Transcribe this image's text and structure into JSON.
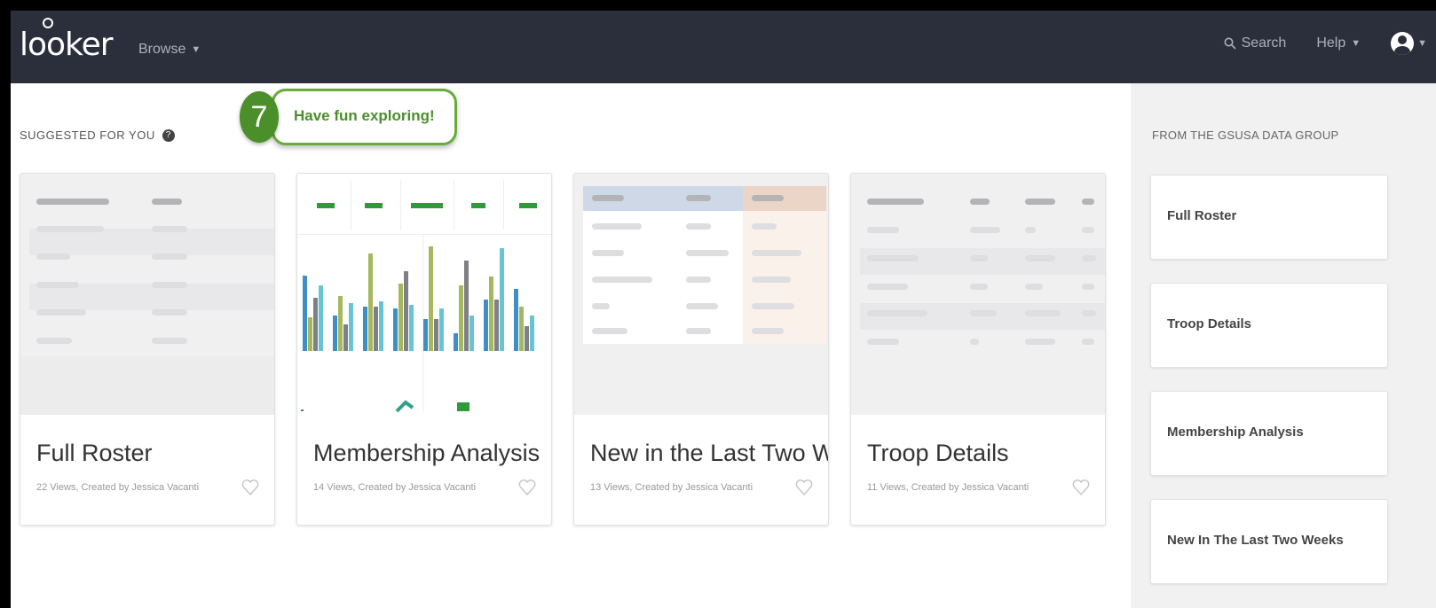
{
  "nav": {
    "logo": "looker",
    "browse": "Browse",
    "search": "Search",
    "help": "Help"
  },
  "main": {
    "section_label": "SUGGESTED FOR YOU",
    "help_glyph": "?",
    "callout": {
      "number": "7",
      "text": "Have fun exploring!"
    },
    "cards": [
      {
        "title": "Full Roster",
        "meta": "22 Views, Created by Jessica Vacanti"
      },
      {
        "title": "Membership Analysis",
        "meta": "14 Views, Created by Jessica Vacanti"
      },
      {
        "title": "New in the Last Two W...",
        "meta": "13 Views, Created by Jessica Vacanti"
      },
      {
        "title": "Troop Details",
        "meta": "11 Views, Created by Jessica Vacanti"
      }
    ]
  },
  "sidebar": {
    "heading": "FROM THE GSUSA DATA GROUP",
    "items": [
      {
        "label": "Full Roster"
      },
      {
        "label": "Troop Details"
      },
      {
        "label": "Membership Analysis"
      },
      {
        "label": "New In The Last Two Weeks"
      }
    ]
  },
  "colors": {
    "nav_bg": "#2b2f3b",
    "accent_green": "#4b8f2b",
    "bar_blue": "#3d8fc6",
    "bar_olive": "#a5b85d",
    "bar_gray": "#7f7f87",
    "bar_cyan": "#67c5d2"
  },
  "icons": [
    "search-icon",
    "chevron-down-icon",
    "help-icon",
    "heart-icon",
    "user-avatar-icon"
  ]
}
